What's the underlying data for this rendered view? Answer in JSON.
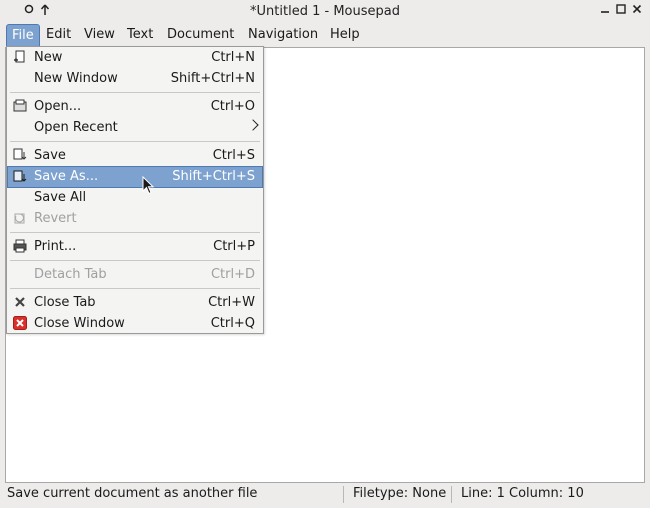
{
  "window": {
    "title": "*Untitled 1 - Mousepad"
  },
  "menubar": {
    "file": "File",
    "edit": "Edit",
    "view": "View",
    "text": "Text",
    "document": "Document",
    "navigation": "Navigation",
    "help": "Help"
  },
  "file_menu": {
    "new": {
      "label": "New",
      "accel": "Ctrl+N"
    },
    "new_window": {
      "label": "New Window",
      "accel": "Shift+Ctrl+N"
    },
    "open": {
      "label": "Open...",
      "accel": "Ctrl+O"
    },
    "open_recent": {
      "label": "Open Recent"
    },
    "save": {
      "label": "Save",
      "accel": "Ctrl+S"
    },
    "save_as": {
      "label": "Save As...",
      "accel": "Shift+Ctrl+S"
    },
    "save_all": {
      "label": "Save All"
    },
    "revert": {
      "label": "Revert"
    },
    "print": {
      "label": "Print...",
      "accel": "Ctrl+P"
    },
    "detach_tab": {
      "label": "Detach Tab",
      "accel": "Ctrl+D"
    },
    "close_tab": {
      "label": "Close Tab",
      "accel": "Ctrl+W"
    },
    "close_window": {
      "label": "Close Window",
      "accel": "Ctrl+Q"
    }
  },
  "statusbar": {
    "message": "Save current document as another file",
    "filetype": "Filetype: None",
    "position": "Line: 1 Column: 10"
  },
  "colors": {
    "highlight": "#7ea2cf",
    "close_window_icon": "#d9302a"
  }
}
